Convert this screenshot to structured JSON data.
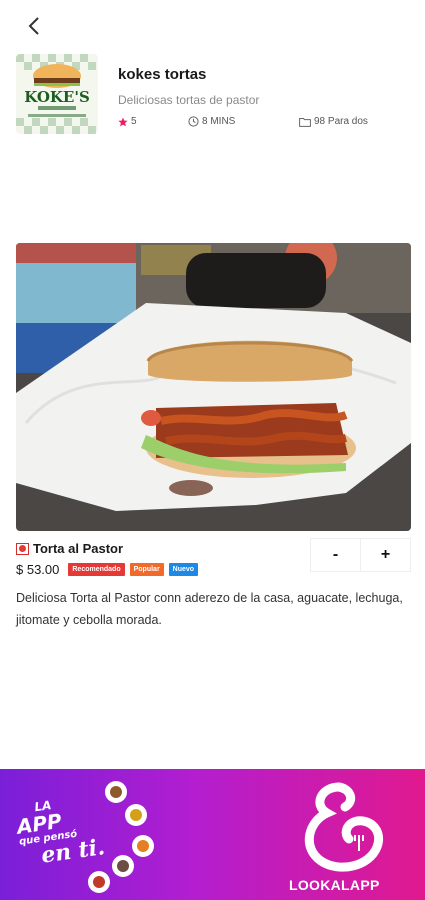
{
  "store": {
    "name": "kokes tortas",
    "description": "Deliciosas tortas de pastor",
    "rating": "5",
    "delivery_time": "8 MINS",
    "price_for_two": "98 Para dos",
    "logo_text": "KOKE'S"
  },
  "product": {
    "name": "Torta al Pastor",
    "price": "$ 53.00",
    "tags": [
      {
        "label": "Recomendado",
        "color": "#e53935"
      },
      {
        "label": "Popular",
        "color": "#f26a2a"
      },
      {
        "label": "Nuevo",
        "color": "#1e88e5"
      }
    ],
    "description": "Deliciosa Torta al Pastor conn aderezo de la casa, aguacate, lechuga, jitomate y cebolla morada.",
    "qty_minus": "-",
    "qty_plus": "+"
  },
  "banner": {
    "line1": "LA",
    "line2": "APP",
    "line3": "que pensó",
    "line4": "en ti.",
    "brand": "LOOKALAPP"
  },
  "colors": {
    "rating_star": "#e91e63",
    "banner_start": "#7a1fd8",
    "banner_end": "#e1198f"
  },
  "icons": {
    "back": "chevron-left-icon",
    "rating": "star-icon",
    "time": "clock-icon",
    "price": "folder-icon"
  }
}
